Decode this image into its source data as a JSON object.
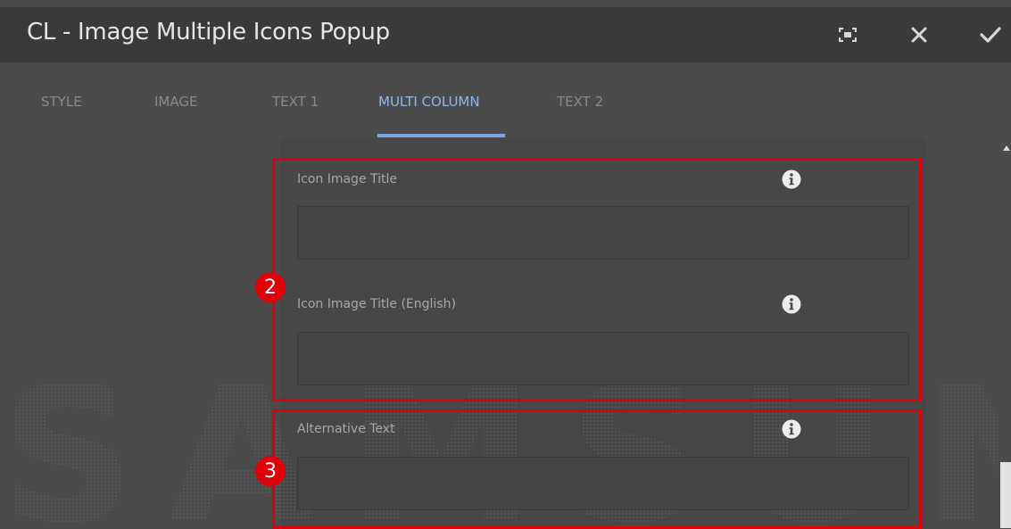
{
  "window": {
    "title": "CL - Image Multiple Icons Popup",
    "buttons": {
      "fullscreen_icon": "fullscreen-icon",
      "close_icon": "close-icon",
      "done_icon": "checkmark-icon"
    }
  },
  "tabs": [
    {
      "label": "STYLE",
      "active": false
    },
    {
      "label": "IMAGE",
      "active": false
    },
    {
      "label": "TEXT 1",
      "active": false
    },
    {
      "label": "MULTI COLUMN",
      "active": true
    },
    {
      "label": "TEXT 2",
      "active": false
    }
  ],
  "fields": [
    {
      "label": "Icon Image Title",
      "value": ""
    },
    {
      "label": "Icon Image Title (English)",
      "value": ""
    },
    {
      "label": "Alternative Text",
      "value": ""
    }
  ],
  "annotations": [
    {
      "number": "2"
    },
    {
      "number": "3"
    }
  ],
  "watermark": {
    "text": "SAMSUNG"
  },
  "colors": {
    "accent": "#7aa8e6",
    "annotation_red": "#e0000a",
    "header_bg": "#3a3a3a",
    "body_bg": "#4b4b4b"
  }
}
